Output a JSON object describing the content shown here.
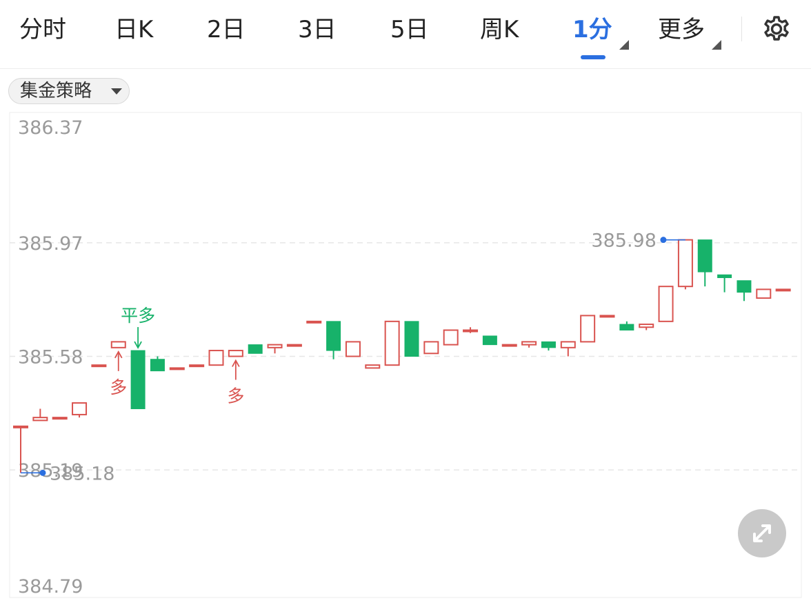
{
  "tabs": [
    {
      "label": "分时"
    },
    {
      "label": "日K"
    },
    {
      "label": "2日"
    },
    {
      "label": "3日"
    },
    {
      "label": "5日"
    },
    {
      "label": "周K"
    },
    {
      "label": "1分"
    },
    {
      "label": "更多"
    }
  ],
  "active_tab": "1分",
  "strategy_label": "集金策略",
  "icons": {
    "settings": "gear-icon",
    "expand": "expand-arrows-icon",
    "dropdown": "triangle-down-icon"
  },
  "colors": {
    "up": "#d9534f",
    "down": "#17b26a",
    "accent": "#2b6fe0"
  },
  "chart_data": {
    "type": "candlestick",
    "y_ticks": [
      "386.37",
      "385.97",
      "385.58",
      "385.19",
      "384.79"
    ],
    "y_tick_values": [
      386.37,
      385.97,
      385.58,
      385.19,
      384.79
    ],
    "ylim": [
      384.79,
      386.37
    ],
    "grid": "horizontal dashed",
    "candles": [
      {
        "o": 385.34,
        "c": 385.34,
        "h": 385.34,
        "l": 385.18
      },
      {
        "o": 385.36,
        "c": 385.37,
        "h": 385.4,
        "l": 385.36
      },
      {
        "o": 385.37,
        "c": 385.37,
        "h": 385.37,
        "l": 385.37
      },
      {
        "o": 385.38,
        "c": 385.42,
        "h": 385.42,
        "l": 385.37
      },
      {
        "o": 385.55,
        "c": 385.55,
        "h": 385.55,
        "l": 385.55
      },
      {
        "o": 385.61,
        "c": 385.63,
        "h": 385.63,
        "l": 385.61
      },
      {
        "o": 385.6,
        "c": 385.4,
        "h": 385.6,
        "l": 385.4
      },
      {
        "o": 385.57,
        "c": 385.53,
        "h": 385.58,
        "l": 385.53
      },
      {
        "o": 385.54,
        "c": 385.54,
        "h": 385.54,
        "l": 385.54
      },
      {
        "o": 385.55,
        "c": 385.55,
        "h": 385.55,
        "l": 385.55
      },
      {
        "o": 385.55,
        "c": 385.6,
        "h": 385.6,
        "l": 385.55
      },
      {
        "o": 385.58,
        "c": 385.6,
        "h": 385.6,
        "l": 385.58
      },
      {
        "o": 385.62,
        "c": 385.59,
        "h": 385.62,
        "l": 385.59
      },
      {
        "o": 385.61,
        "c": 385.62,
        "h": 385.62,
        "l": 385.59
      },
      {
        "o": 385.62,
        "c": 385.62,
        "h": 385.62,
        "l": 385.62
      },
      {
        "o": 385.7,
        "c": 385.7,
        "h": 385.7,
        "l": 385.7
      },
      {
        "o": 385.7,
        "c": 385.6,
        "h": 385.7,
        "l": 385.57
      },
      {
        "o": 385.58,
        "c": 385.63,
        "h": 385.63,
        "l": 385.58
      },
      {
        "o": 385.54,
        "c": 385.55,
        "h": 385.55,
        "l": 385.54
      },
      {
        "o": 385.55,
        "c": 385.7,
        "h": 385.7,
        "l": 385.55
      },
      {
        "o": 385.7,
        "c": 385.58,
        "h": 385.7,
        "l": 385.58
      },
      {
        "o": 385.59,
        "c": 385.63,
        "h": 385.63,
        "l": 385.59
      },
      {
        "o": 385.62,
        "c": 385.67,
        "h": 385.67,
        "l": 385.62
      },
      {
        "o": 385.67,
        "c": 385.67,
        "h": 385.68,
        "l": 385.66
      },
      {
        "o": 385.65,
        "c": 385.62,
        "h": 385.65,
        "l": 385.62
      },
      {
        "o": 385.62,
        "c": 385.62,
        "h": 385.62,
        "l": 385.62
      },
      {
        "o": 385.62,
        "c": 385.63,
        "h": 385.63,
        "l": 385.61
      },
      {
        "o": 385.63,
        "c": 385.61,
        "h": 385.63,
        "l": 385.6
      },
      {
        "o": 385.61,
        "c": 385.63,
        "h": 385.63,
        "l": 385.58
      },
      {
        "o": 385.63,
        "c": 385.72,
        "h": 385.72,
        "l": 385.63
      },
      {
        "o": 385.72,
        "c": 385.72,
        "h": 385.72,
        "l": 385.72
      },
      {
        "o": 385.69,
        "c": 385.67,
        "h": 385.7,
        "l": 385.67
      },
      {
        "o": 385.68,
        "c": 385.69,
        "h": 385.69,
        "l": 385.67
      },
      {
        "o": 385.7,
        "c": 385.82,
        "h": 385.82,
        "l": 385.7
      },
      {
        "o": 385.82,
        "c": 385.98,
        "h": 385.98,
        "l": 385.81
      },
      {
        "o": 385.98,
        "c": 385.87,
        "h": 385.98,
        "l": 385.82
      },
      {
        "o": 385.86,
        "c": 385.85,
        "h": 385.86,
        "l": 385.8
      },
      {
        "o": 385.84,
        "c": 385.8,
        "h": 385.84,
        "l": 385.77
      },
      {
        "o": 385.78,
        "c": 385.81,
        "h": 385.81,
        "l": 385.78
      },
      {
        "o": 385.81,
        "c": 385.81,
        "h": 385.81,
        "l": 385.81
      }
    ],
    "extremes": [
      {
        "label": "385.98",
        "index": 34,
        "value": 385.98,
        "side": "left"
      },
      {
        "label": "385.18",
        "index": 0,
        "value": 385.18,
        "side": "right"
      }
    ],
    "signals": [
      {
        "label": "多",
        "index": 5,
        "pos": "below",
        "color": "up"
      },
      {
        "label": "平多",
        "index": 6,
        "pos": "above",
        "color": "down"
      },
      {
        "label": "多",
        "index": 11,
        "pos": "below",
        "color": "up"
      }
    ]
  }
}
